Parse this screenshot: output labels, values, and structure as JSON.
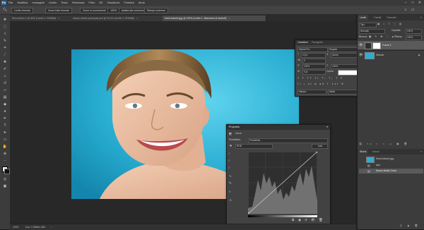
{
  "app": {
    "logo": "Ps",
    "menus": [
      "File",
      "Modifica",
      "Immagine",
      "Livello",
      "Testo",
      "Seleziona",
      "Filtro",
      "3D",
      "Visualizza",
      "Finestra",
      "Aiuto"
    ],
    "window_controls": [
      "–",
      "□",
      "✕"
    ]
  },
  "options_bar": {
    "chips": [
      "Livello finestra",
      "Zoom tutte finestre",
      "Zoom in scorrimento",
      "100%",
      "Adatta allo schermo",
      "Riempi schermo"
    ]
  },
  "doc_tabs": [
    {
      "label": "Senza titolo-1 @ 50% (Livello 1, RGB/8#)",
      "active": false
    },
    {
      "label": "ritocco-ritratto-principale.psd @ 33,3% (Livello 1, RGB/8#)",
      "active": false
    },
    {
      "label": "Denti-bianchi.jpg @ 100% (Livello 1, Maschera di livello/8)",
      "active": true
    }
  ],
  "status": {
    "zoom": "100%",
    "doc": "Doc: 2,25M/6,13M"
  },
  "layers_panel": {
    "tabs": [
      "Livelli",
      "Canali",
      "Tracciati"
    ],
    "kind_label": "Tipo",
    "blend_mode": "Normale",
    "opacity_label": "Opacità:",
    "opacity_value": "100%",
    "lock_label": "Blocca:",
    "fill_label": "Riemp.:",
    "fill_value": "100%",
    "layers": [
      {
        "name": "Curve 1",
        "selected": true
      },
      {
        "name": "Sfondo",
        "selected": false
      }
    ]
  },
  "history_panel": {
    "tabs": [
      "Storia",
      "Azioni"
    ],
    "items": [
      "Denti-bianchi.jpg",
      "Apri",
      "Nuovo livello Curve"
    ]
  },
  "character_panel": {
    "tabs": [
      "Carattere",
      "Paragrafo"
    ],
    "font_family": "Myriad Pro",
    "font_style": "Regular",
    "size": "12 pt",
    "leading": "(Auto)",
    "tracking": "0",
    "scale_v": "100%",
    "scale_h": "100%",
    "baseline": "0 pt",
    "color_label": "Colore:",
    "language": "Italiano",
    "antialias": "Nitido"
  },
  "properties_panel": {
    "title": "Proprietà",
    "adjustment_label": "Curve",
    "preset_label": "Predefinito:",
    "preset_value": "Predefinito",
    "channel": "RGB",
    "auto_button": "Auto"
  },
  "colors": {
    "accent": "#2d8ceb",
    "image_bg": "#2aaed1"
  }
}
